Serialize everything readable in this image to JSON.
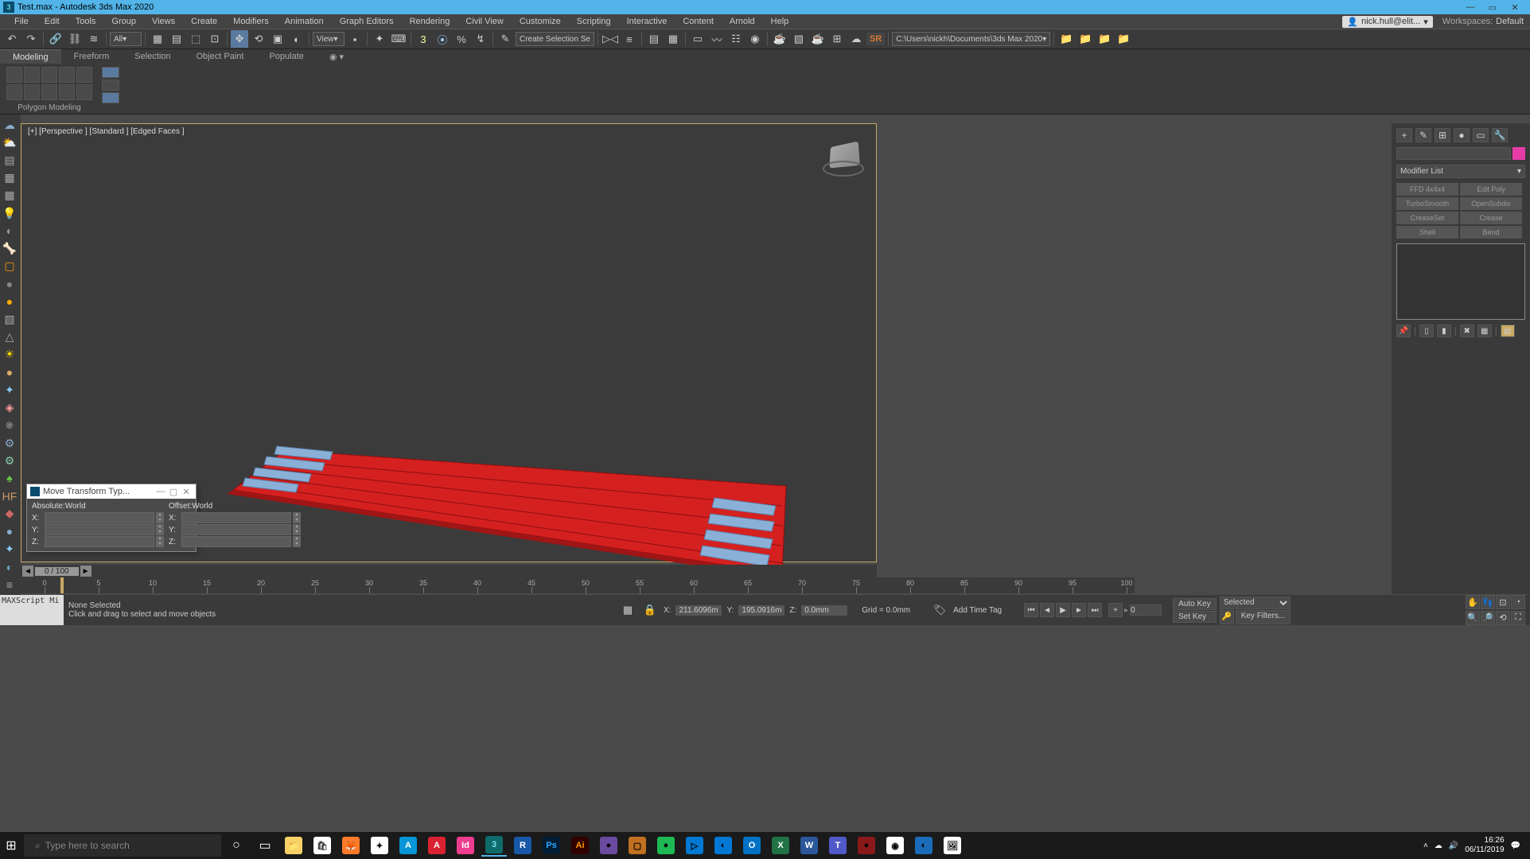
{
  "titlebar": {
    "title": "Test.max - Autodesk 3ds Max 2020"
  },
  "menubar": {
    "items": [
      "File",
      "Edit",
      "Tools",
      "Group",
      "Views",
      "Create",
      "Modifiers",
      "Animation",
      "Graph Editors",
      "Rendering",
      "Civil View",
      "Customize",
      "Scripting",
      "Interactive",
      "Content",
      "Arnold",
      "Help"
    ],
    "user": "nick.hull@elit...",
    "workspace_label": "Workspaces:",
    "workspace_value": "Default"
  },
  "toolbar": {
    "selection_filter": "All",
    "view_label": "View",
    "create_sel": "Create Selection Se",
    "sr": "SR",
    "project_path": "C:\\Users\\nickh\\Documents\\3ds Max 2020"
  },
  "ribbon": {
    "tabs": [
      "Modeling",
      "Freeform",
      "Selection",
      "Object Paint",
      "Populate"
    ],
    "polygon_label": "Polygon Modeling"
  },
  "viewport": {
    "label": "[+] [Perspective ] [Standard ] [Edged Faces ]"
  },
  "mtt": {
    "title": "Move Transform Typ...",
    "abs_header": "Absolute:World",
    "off_header": "Offset:World",
    "rows": [
      "X:",
      "Y:",
      "Z:"
    ]
  },
  "timeslider": {
    "label": "0 / 100"
  },
  "ruler_ticks": [
    0,
    5,
    10,
    15,
    20,
    25,
    30,
    35,
    40,
    45,
    50,
    55,
    60,
    65,
    70,
    75,
    80,
    85,
    90,
    95,
    100
  ],
  "status": {
    "maxscript": "MAXScript Mi",
    "selection": "None Selected",
    "help": "Click and drag to select and move objects",
    "x": "211.6096m",
    "y": "195.0916m",
    "z": "0.0mm",
    "grid": "Grid = 0.0mm",
    "frame_val": "0",
    "add_time_tag": "Add Time Tag",
    "auto_key": "Auto Key",
    "set_key": "Set Key",
    "key_mode": "Selected",
    "key_filters": "Key Filters..."
  },
  "right_panel": {
    "modifier_list": "Modifier List",
    "buttons": [
      "FFD 4x4x4",
      "Edit Poly",
      "TurboSmooth",
      "OpenSubdiv",
      "CreaseSet",
      "Crease",
      "Shell",
      "Bend"
    ]
  },
  "taskbar": {
    "search_placeholder": "Type here to search",
    "time": "16:26",
    "date": "06/11/2019"
  }
}
